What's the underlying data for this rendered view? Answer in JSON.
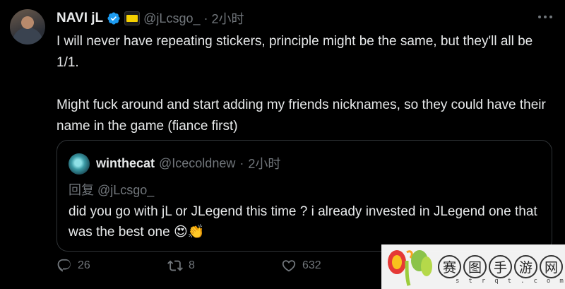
{
  "tweet": {
    "author_name": "NAVI jL",
    "handle": "@jLcsgo_",
    "separator": "·",
    "time": "2小时",
    "verified_icon": "verified-badge-icon",
    "team_icon": "navi-team-badge-icon",
    "paragraphs": [
      "I will never have repeating stickers, principle might be the same, but they'll all be 1/1.",
      "Might fuck around and start adding my friends nicknames, so they could have their name in the game (fiance first)"
    ]
  },
  "quote": {
    "author_name": "winthecat",
    "handle": "@Icecoldnew",
    "separator": "·",
    "time": "2小时",
    "reply_to": "回复 @jLcsgo_",
    "text": "did you go with jL or JLegend this time ? i already invested in JLegend one that was the best one",
    "emojis": "😍👏"
  },
  "actions": {
    "reply_count": "26",
    "retweet_count": "8",
    "like_count": "632"
  },
  "watermark": {
    "chars": [
      "赛",
      "图",
      "手",
      "游",
      "网"
    ],
    "subtitle": "strqt.com"
  },
  "colors": {
    "background": "#000000",
    "text_primary": "#e7e9ea",
    "text_secondary": "#71767b",
    "verified_blue": "#1d9bf0",
    "border": "#2f3336"
  }
}
